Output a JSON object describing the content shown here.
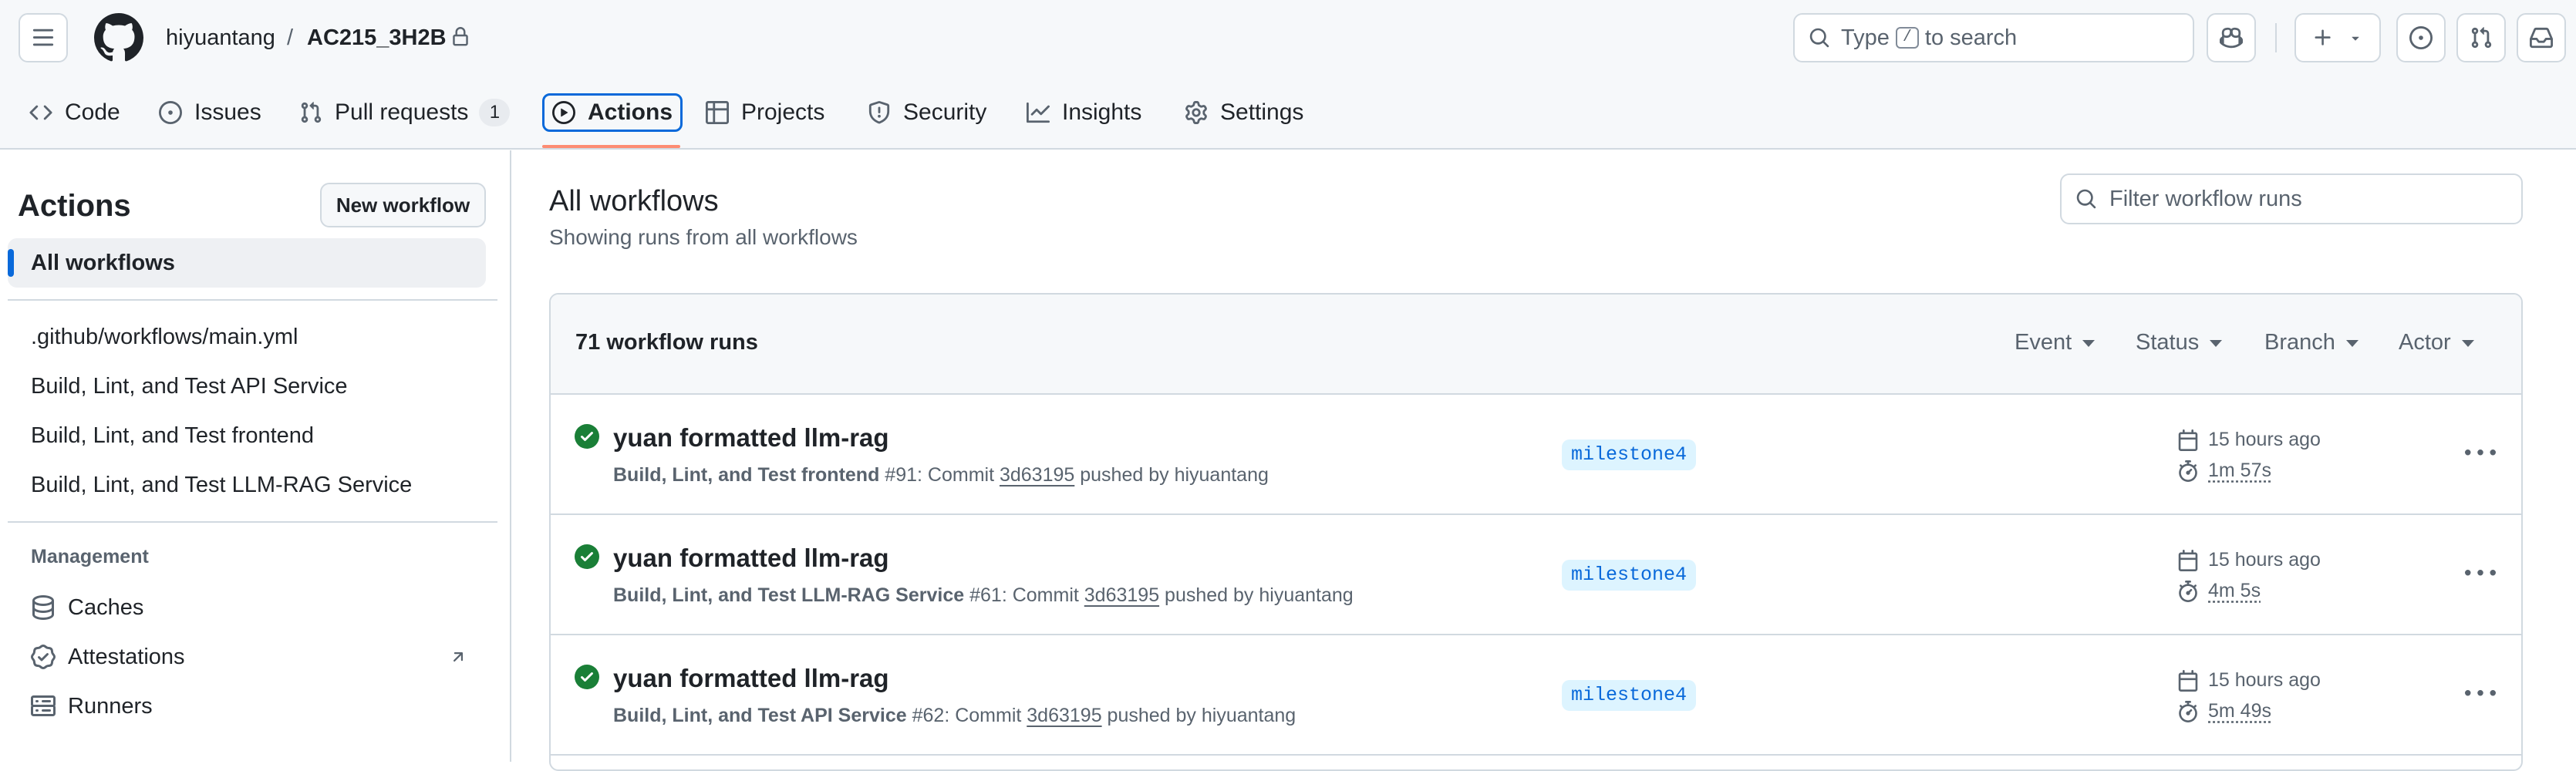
{
  "header": {
    "owner": "hiyuantang",
    "separator": "/",
    "repo": "AC215_3H2B",
    "search_placeholder_before": "Type",
    "search_key": "/",
    "search_placeholder_after": "to search"
  },
  "tabs": [
    {
      "label": "Code",
      "icon": "code-icon"
    },
    {
      "label": "Issues",
      "icon": "issue-opened-icon"
    },
    {
      "label": "Pull requests",
      "icon": "git-pull-request-icon",
      "count": "1"
    },
    {
      "label": "Actions",
      "icon": "play-icon",
      "active": true
    },
    {
      "label": "Projects",
      "icon": "table-icon"
    },
    {
      "label": "Security",
      "icon": "shield-icon"
    },
    {
      "label": "Insights",
      "icon": "graph-icon"
    },
    {
      "label": "Settings",
      "icon": "gear-icon"
    }
  ],
  "sidebar": {
    "title": "Actions",
    "new_workflow": "New workflow",
    "all_workflows": "All workflows",
    "workflows": [
      ".github/workflows/main.yml",
      "Build, Lint, and Test API Service",
      "Build, Lint, and Test frontend",
      "Build, Lint, and Test LLM-RAG Service"
    ],
    "management_label": "Management",
    "management": [
      {
        "label": "Caches",
        "icon": "database-icon"
      },
      {
        "label": "Attestations",
        "icon": "verified-icon"
      },
      {
        "label": "Runners",
        "icon": "server-icon"
      }
    ]
  },
  "main": {
    "title": "All workflows",
    "subtitle": "Showing runs from all workflows",
    "filter_placeholder": "Filter workflow runs",
    "runs_count": "71 workflow runs",
    "facets": [
      "Event",
      "Status",
      "Branch",
      "Actor"
    ],
    "runs": [
      {
        "title": "yuan formatted llm-rag",
        "workflow": "Build, Lint, and Test frontend",
        "number": "#91",
        "commit_label": ": Commit",
        "sha": "3d63195",
        "pushed_by": "pushed by hiyuantang",
        "branch": "milestone4",
        "when": "15 hours ago",
        "duration": "1m 57s",
        "status": "success"
      },
      {
        "title": "yuan formatted llm-rag",
        "workflow": "Build, Lint, and Test LLM-RAG Service",
        "number": "#61",
        "commit_label": ": Commit",
        "sha": "3d63195",
        "pushed_by": "pushed by hiyuantang",
        "branch": "milestone4",
        "when": "15 hours ago",
        "duration": "4m 5s",
        "status": "success"
      },
      {
        "title": "yuan formatted llm-rag",
        "workflow": "Build, Lint, and Test API Service",
        "number": "#62",
        "commit_label": ": Commit",
        "sha": "3d63195",
        "pushed_by": "pushed by hiyuantang",
        "branch": "milestone4",
        "when": "15 hours ago",
        "duration": "5m 49s",
        "status": "success"
      }
    ]
  },
  "colors": {
    "accent": "#0969da",
    "success": "#1a7f37",
    "tab_underline": "#fd8c73",
    "branch_bg": "#ddf4ff"
  }
}
